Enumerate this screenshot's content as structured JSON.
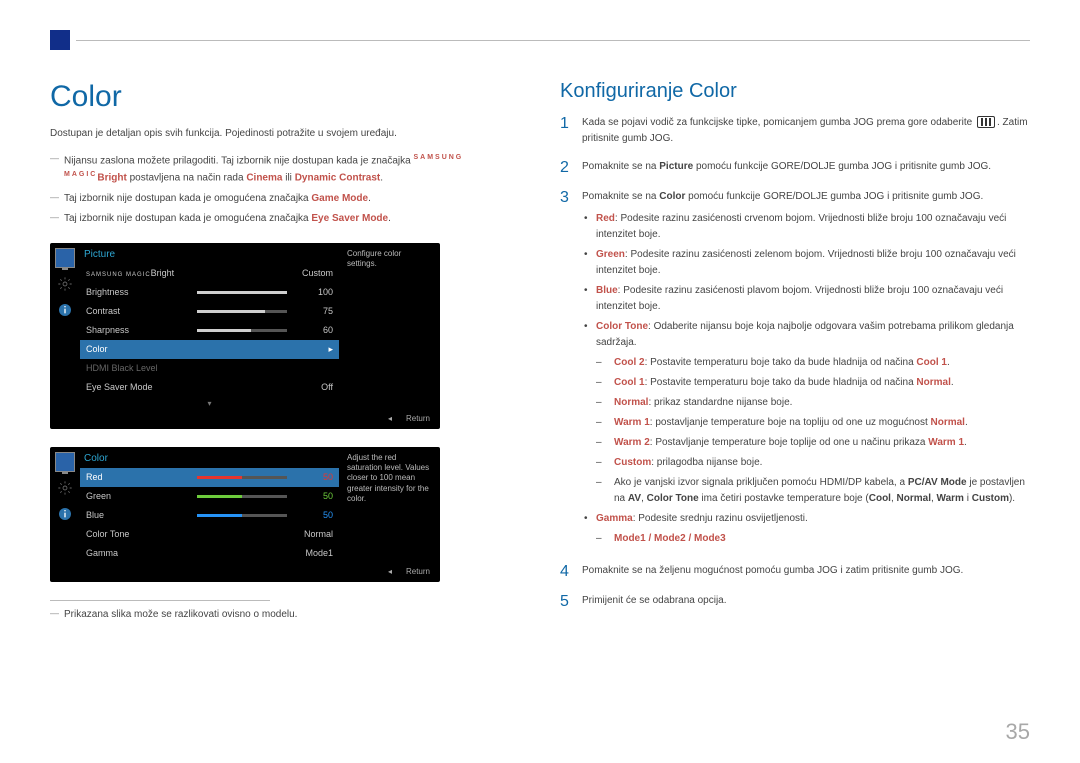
{
  "page_number": "35",
  "left": {
    "heading": "Color",
    "intro": "Dostupan je detaljan opis svih funkcija. Pojedinosti potražite u svojem uređaju.",
    "notes": [
      {
        "pre": "Nijansu zaslona možete prilagoditi. Taj izbornik nije dostupan kada je značajka ",
        "magic": "SAMSUNG MAGIC",
        "bright": "Bright",
        "mid": " postavljena na način rada ",
        "red1": "Cinema",
        "or": " ili ",
        "red2": "Dynamic Contrast",
        "post": "."
      },
      {
        "text": "Taj izbornik nije dostupan kada je omogućena značajka ",
        "red": "Game Mode",
        "post": "."
      },
      {
        "text": "Taj izbornik nije dostupan kada je omogućena značajka ",
        "red": "Eye Saver Mode",
        "post": "."
      }
    ],
    "footnote": "Prikazana slika može se razlikovati ovisno o modelu."
  },
  "osd1": {
    "title": "Picture",
    "help": "Configure color settings.",
    "return": "Return",
    "rows": [
      {
        "label": "",
        "magic": "SAMSUNG MAGIC",
        "suffix": "Bright",
        "value": "Custom",
        "bar": null
      },
      {
        "label": "Brightness",
        "value": "100",
        "bar": {
          "color": "#cfcfcf",
          "pct": 100
        }
      },
      {
        "label": "Contrast",
        "value": "75",
        "bar": {
          "color": "#cfcfcf",
          "pct": 75
        }
      },
      {
        "label": "Sharpness",
        "value": "60",
        "bar": {
          "color": "#cfcfcf",
          "pct": 60
        }
      },
      {
        "label": "Color",
        "value": "",
        "selected": true,
        "arrow": true
      },
      {
        "label": "HDMI Black Level",
        "value": "",
        "dim": true
      },
      {
        "label": "Eye Saver Mode",
        "value": "Off"
      }
    ]
  },
  "osd2": {
    "title": "Color",
    "help": "Adjust the red saturation level. Values closer to 100 mean greater intensity for the color.",
    "return": "Return",
    "rows": [
      {
        "label": "Red",
        "value": "50",
        "valColor": "#e7352e",
        "bar": {
          "color": "#e7352e",
          "pct": 50
        },
        "selected": true
      },
      {
        "label": "Green",
        "value": "50",
        "valColor": "#6dcc3c",
        "bar": {
          "color": "#6dcc3c",
          "pct": 50
        }
      },
      {
        "label": "Blue",
        "value": "50",
        "valColor": "#2693f7",
        "bar": {
          "color": "#2693f7",
          "pct": 50
        }
      },
      {
        "label": "Color Tone",
        "value": "Normal"
      },
      {
        "label": "Gamma",
        "value": "Mode1"
      }
    ]
  },
  "right": {
    "heading": "Konfiguriranje Color",
    "steps": [
      {
        "n": "1",
        "body": [
          {
            "t": "Kada se pojavi vodič za funkcijske tipke, pomicanjem gumba JOG prema gore odaberite "
          },
          {
            "icon": true
          },
          {
            "t": ". Zatim pritisnite gumb JOG."
          }
        ]
      },
      {
        "n": "2",
        "body": [
          {
            "t": "Pomaknite se na "
          },
          {
            "b": "Picture"
          },
          {
            "t": " pomoću funkcije GORE/DOLJE gumba JOG i pritisnite gumb JOG."
          }
        ]
      },
      {
        "n": "3",
        "body": [
          {
            "t": "Pomaknite se na "
          },
          {
            "b": "Color"
          },
          {
            "t": " pomoću funkcije GORE/DOLJE gumba JOG i pritisnite gumb JOG."
          }
        ],
        "bullets": [
          {
            "lead": "Red",
            "leadColor": "#c1524b",
            "text": ": Podesite razinu zasićenosti crvenom bojom. Vrijednosti bliže broju 100 označavaju veći intenzitet boje."
          },
          {
            "lead": "Green",
            "leadColor": "#c1524b",
            "text": ": Podesite razinu zasićenosti zelenom bojom. Vrijednosti bliže broju 100 označavaju veći intenzitet boje."
          },
          {
            "lead": "Blue",
            "leadColor": "#c1524b",
            "text": ": Podesite razinu zasićenosti plavom bojom. Vrijednosti bliže broju 100 označavaju veći intenzitet boje."
          },
          {
            "lead": "Color Tone",
            "leadColor": "#c1524b",
            "text": ": Odaberite nijansu boje koja najbolje odgovara vašim potrebama prilikom gledanja sadržaja.",
            "sub": [
              {
                "lead": "Cool 2",
                "text": ": Postavite temperaturu boje tako da bude hladnija od načina ",
                "tail": "Cool 1",
                "tailColor": "#c1524b",
                "post": "."
              },
              {
                "lead": "Cool 1",
                "text": ": Postavite temperaturu boje tako da bude hladnija od načina ",
                "tail": "Normal",
                "tailColor": "#c1524b",
                "post": "."
              },
              {
                "lead": "Normal",
                "text": ": prikaz standardne nijanse boje."
              },
              {
                "lead": "Warm 1",
                "text": ": postavljanje temperature boje na topliju od one uz mogućnost ",
                "tail": "Normal",
                "tailColor": "#c1524b",
                "post": "."
              },
              {
                "lead": "Warm 2",
                "text": ": Postavljanje temperature boje toplije od one u načinu prikaza ",
                "tail": "Warm 1",
                "tailColor": "#c1524b",
                "post": "."
              },
              {
                "lead": "Custom",
                "text": ": prilagodba nijanse boje."
              },
              {
                "note": true,
                "pre": "Ako je vanjski izvor signala priključen pomoću HDMI/DP kabela, a ",
                "b1": "PC/AV Mode",
                "mid": " je postavljen na ",
                "b2": "AV",
                "mid2": ", ",
                "b3": "Color Tone",
                "post": " ima četiri postavke temperature boje (",
                "c1": "Cool",
                "s": ", ",
                "c2": "Normal",
                "s2": ", ",
                "c3": "Warm",
                "s3": " i ",
                "c4": "Custom",
                "end": ")."
              }
            ]
          },
          {
            "lead": "Gamma",
            "leadColor": "#c1524b",
            "text": ": Podesite srednju razinu osvijetljenosti.",
            "sub": [
              {
                "modes": "Mode1 / Mode2 / Mode3"
              }
            ]
          }
        ]
      },
      {
        "n": "4",
        "body": [
          {
            "t": "Pomaknite se na željenu mogućnost pomoću gumba JOG i zatim pritisnite gumb JOG."
          }
        ]
      },
      {
        "n": "5",
        "body": [
          {
            "t": "Primijenit će se odabrana opcija."
          }
        ]
      }
    ]
  }
}
